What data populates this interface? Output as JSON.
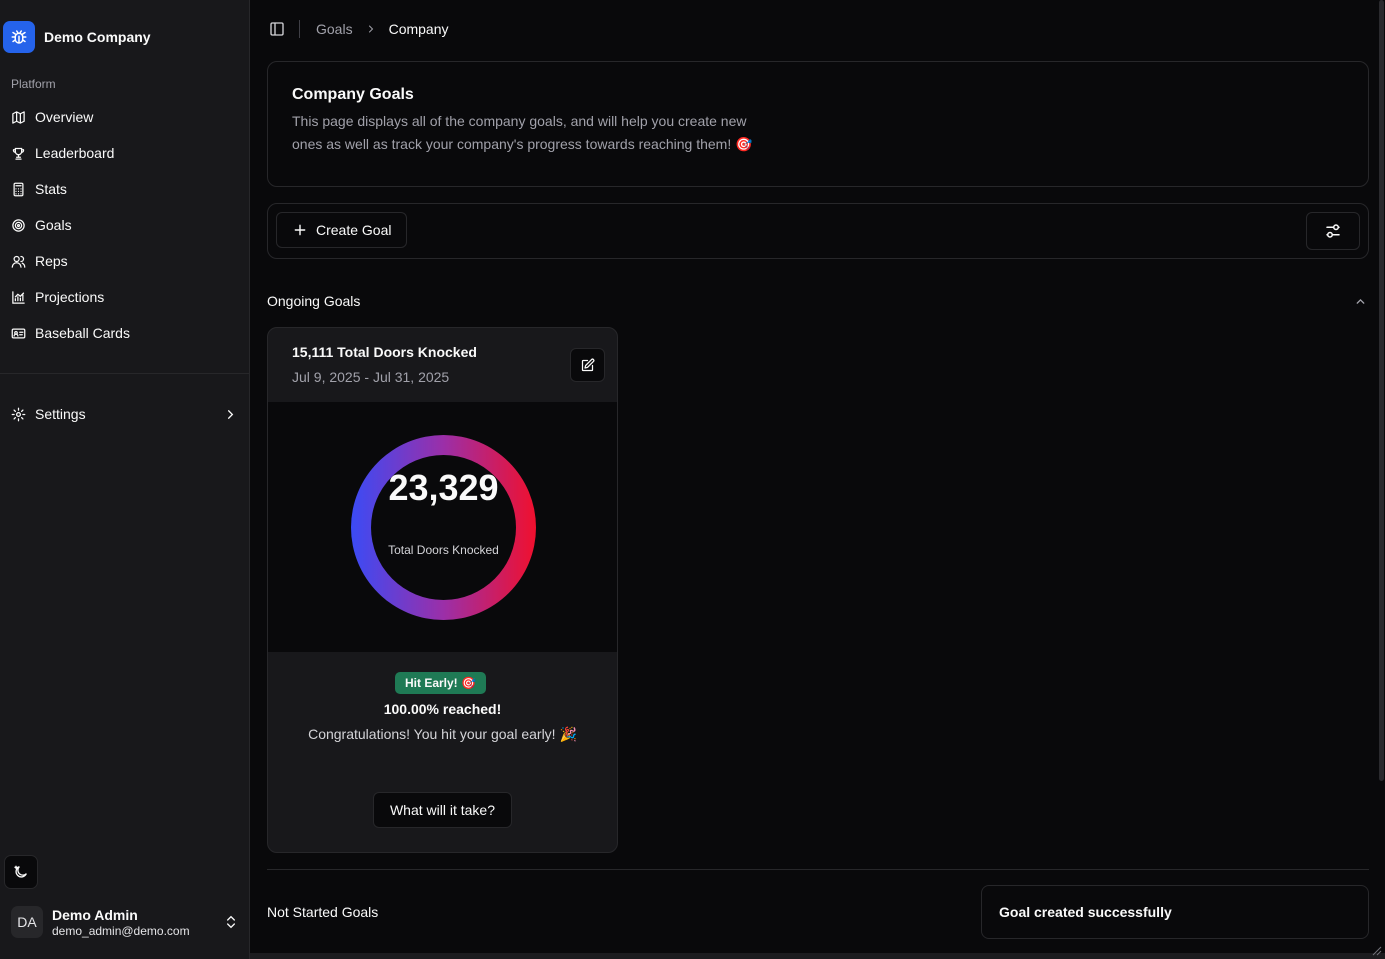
{
  "sidebar": {
    "brand_name": "Demo Company",
    "group_label": "Platform",
    "items": [
      {
        "label": "Overview",
        "icon": "map-icon"
      },
      {
        "label": "Leaderboard",
        "icon": "trophy-icon"
      },
      {
        "label": "Stats",
        "icon": "calculator-icon"
      },
      {
        "label": "Goals",
        "icon": "target-icon"
      },
      {
        "label": "Reps",
        "icon": "users-icon"
      },
      {
        "label": "Projections",
        "icon": "chart-icon"
      },
      {
        "label": "Baseball Cards",
        "icon": "id-card-icon"
      }
    ],
    "settings_label": "Settings",
    "user": {
      "initials": "DA",
      "name": "Demo Admin",
      "email": "demo_admin@demo.com"
    }
  },
  "header": {
    "breadcrumb": [
      "Goals",
      "Company"
    ]
  },
  "intro": {
    "title": "Company Goals",
    "description": "This page displays all of the company goals, and will help you create new ones as well as track your company's progress towards reaching them! 🎯"
  },
  "toolbar": {
    "create_label": "Create Goal"
  },
  "sections": {
    "ongoing": "Ongoing Goals",
    "not_started": "Not Started Goals"
  },
  "goal": {
    "title": "15,111 Total Doors Knocked",
    "dates": "Jul 9, 2025 - Jul 31, 2025",
    "value": "23,329",
    "value_label": "Total Doors Knocked",
    "progress_fraction": 1.0,
    "badge": "Hit Early! 🎯",
    "reached": "100.00% reached!",
    "message": "Congratulations! You hit your goal early! 🎉",
    "action": "What will it take?"
  },
  "toast": {
    "message": "Goal created successfully"
  },
  "colors": {
    "ring_start": "#3b4bf5",
    "ring_end": "#f0102e",
    "badge": "#1f7a55",
    "brand": "#2563eb"
  }
}
